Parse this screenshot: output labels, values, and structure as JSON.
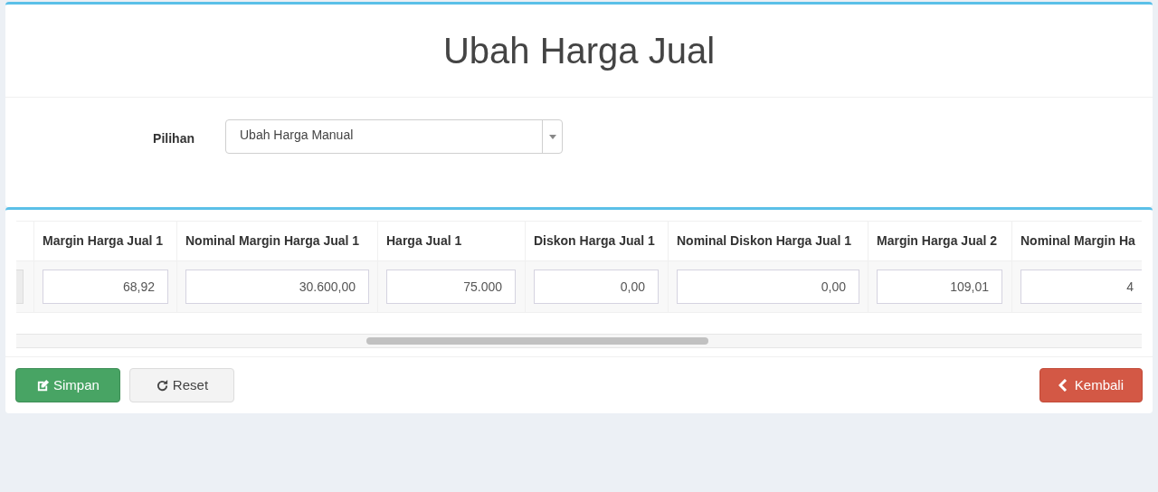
{
  "title": "Ubah Harga Jual",
  "pilihan": {
    "label": "Pilihan",
    "value": "Ubah Harga Manual"
  },
  "table": {
    "columns": [
      {
        "header": "Margin Harga Jual 1",
        "value": "68,92"
      },
      {
        "header": "Nominal Margin Harga Jual 1",
        "value": "30.600,00"
      },
      {
        "header": "Harga Jual 1",
        "value": "75.000"
      },
      {
        "header": "Diskon Harga Jual 1",
        "value": "0,00"
      },
      {
        "header": "Nominal Diskon Harga Jual 1",
        "value": "0,00"
      },
      {
        "header": "Margin Harga Jual 2",
        "value": "109,01"
      },
      {
        "header": "Nominal Margin Ha",
        "value": "4"
      }
    ]
  },
  "buttons": [
    {
      "label": "Simpan",
      "kind": "save"
    },
    {
      "label": "Reset",
      "kind": "reset"
    },
    {
      "label": "Kembali",
      "kind": "back"
    }
  ]
}
